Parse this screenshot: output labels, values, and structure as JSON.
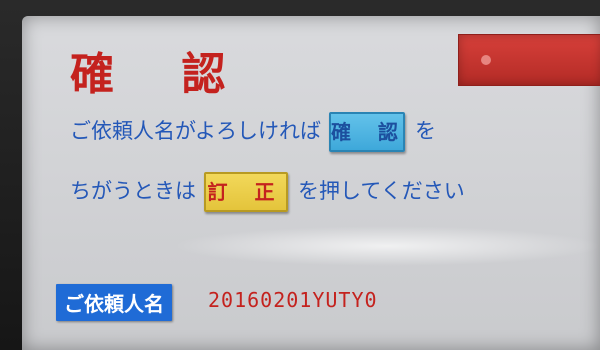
{
  "screen": {
    "title": "確 認",
    "instruction1": {
      "prefix": "ご依頼人名がよろしければ",
      "suffix": "を"
    },
    "instruction2": {
      "prefix": "ちがうときは",
      "suffix": "を押してください"
    }
  },
  "buttons": {
    "confirm_label": "確 認",
    "correct_label": "訂 正"
  },
  "requester": {
    "label": "ご依頼人名",
    "value": "20160201YUTY0"
  },
  "colors": {
    "title_red": "#c4221e",
    "text_blue": "#2458b8",
    "confirm_blue": "#3ea8da",
    "correct_yellow": "#e4c43b",
    "label_blue": "#1f6bd6"
  }
}
